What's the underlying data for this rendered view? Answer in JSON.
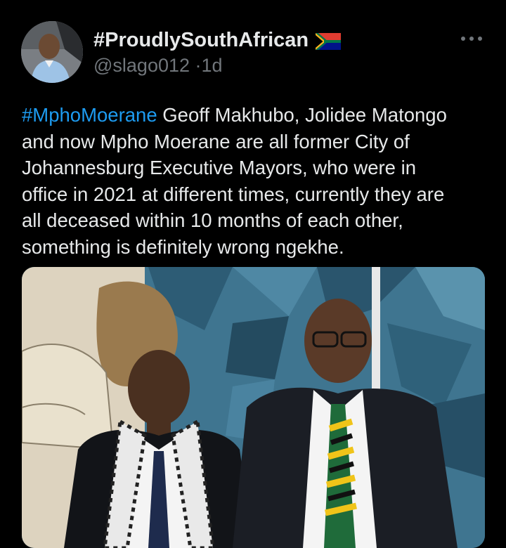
{
  "tweet": {
    "display_name": "#ProudlySouthAfrican",
    "flag_icon": "south-africa-flag-icon",
    "handle": "@slago012",
    "separator": "·",
    "time": "1d",
    "more_icon": "more-horizontal-icon",
    "text": {
      "hashtag": "#MphoMoerane",
      "line1_rest": " Geoff Makhubo, Jolidee Matongo",
      "lines": [
        "and now Mpho Moerane are all former City of",
        "Johannesburg Executive Mayors, who were in",
        "office in 2021 at different times, currently they are",
        "all deceased within 10 months of each other,",
        "something is definitely wrong ngekhe."
      ]
    }
  },
  "colors": {
    "background": "#000000",
    "text": "#e7e9ea",
    "secondary": "#71767b",
    "link": "#1d9bf0"
  }
}
